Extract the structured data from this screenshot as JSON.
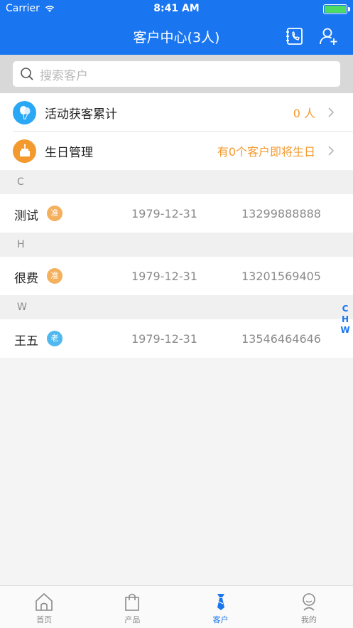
{
  "status": {
    "carrier": "Carrier",
    "time": "8:41 AM"
  },
  "nav": {
    "title": "客户中心(3人)"
  },
  "search": {
    "placeholder": "搜索客户"
  },
  "features": [
    {
      "label": "活动获客累计",
      "value": "0 人",
      "color": "#2aa7f5"
    },
    {
      "label": "生日管理",
      "value": "有0个客户即将生日",
      "color": "#f39a2e"
    }
  ],
  "sections": [
    {
      "letter": "C",
      "contacts": [
        {
          "name": "测试",
          "badge": "准",
          "badge_color": "#f5b05e",
          "date": "1979-12-31",
          "phone": "13299888888"
        }
      ]
    },
    {
      "letter": "H",
      "contacts": [
        {
          "name": "很费",
          "badge": "准",
          "badge_color": "#f5b05e",
          "date": "1979-12-31",
          "phone": "13201569405"
        }
      ]
    },
    {
      "letter": "W",
      "contacts": [
        {
          "name": "王五",
          "badge": "老",
          "badge_color": "#4fb9ef",
          "date": "1979-12-31",
          "phone": "13546464646"
        }
      ]
    }
  ],
  "index": [
    "C",
    "H",
    "W"
  ],
  "tabs": [
    {
      "label": "首页",
      "icon": "home-icon"
    },
    {
      "label": "产品",
      "icon": "bag-icon"
    },
    {
      "label": "客户",
      "icon": "tie-icon",
      "active": true
    },
    {
      "label": "我的",
      "icon": "profile-icon"
    }
  ],
  "colors": {
    "primary": "#1a76f0",
    "accent_orange": "#f39a2e"
  }
}
